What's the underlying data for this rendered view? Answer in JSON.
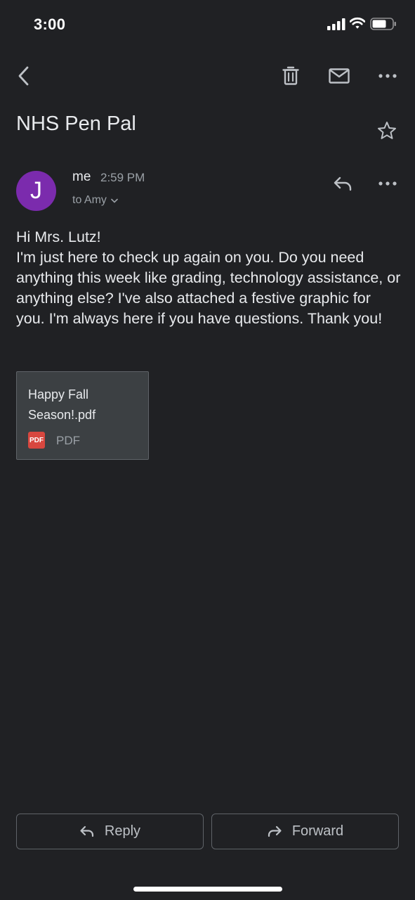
{
  "status_bar": {
    "time": "3:00"
  },
  "toolbar": {
    "back_icon": "chevron-left-icon",
    "trash_icon": "trash-icon",
    "mail_icon": "mail-icon",
    "more_icon": "more-horizontal-icon"
  },
  "email": {
    "subject": "NHS Pen Pal",
    "sender": {
      "avatar_initial": "J",
      "avatar_color": "#7b2bad",
      "name": "me",
      "time": "2:59 PM"
    },
    "recipient_label": "to Amy",
    "body": [
      "Hi Mrs. Lutz!",
      "I'm just here to check up again on you. Do you need anything this week like grading, technology assistance, or anything else? I've also attached a festive graphic for you. I'm always here if you have questions. Thank you!"
    ],
    "attachment": {
      "name": "Happy Fall Season!.pdf",
      "badge": "PDF",
      "type": "PDF",
      "badge_color": "#d8473f"
    }
  },
  "actions": {
    "reply_label": "Reply",
    "forward_label": "Forward"
  },
  "colors": {
    "background": "#202124",
    "text": "#e8eaed",
    "muted": "#9aa0a6"
  }
}
